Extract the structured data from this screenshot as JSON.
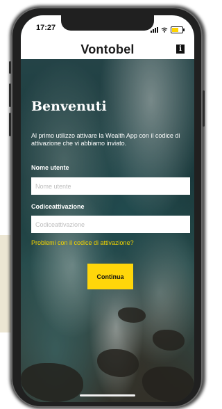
{
  "status_bar": {
    "time": "17:27"
  },
  "header": {
    "brand": "Vontobel",
    "info_icon": "i"
  },
  "welcome": {
    "title": "Benvenuti",
    "intro": "Al primo utilizzo attivare la Wealth App con il codice di attivazione che vi abbiamo inviato."
  },
  "form": {
    "username_label": "Nome utente",
    "username_placeholder": "Nome utente",
    "username_value": "",
    "code_label": "Codiceattivazione",
    "code_placeholder": "Codiceattivazione",
    "code_value": "",
    "help_link": "Problemi con il codice di attivazione?",
    "submit": "Continua"
  },
  "colors": {
    "accent": "#ffd60a",
    "link": "#f2d400",
    "battery_charging": "#ffd400"
  },
  "icons": [
    "signal-icon",
    "wifi-icon",
    "battery-icon",
    "info-icon"
  ]
}
